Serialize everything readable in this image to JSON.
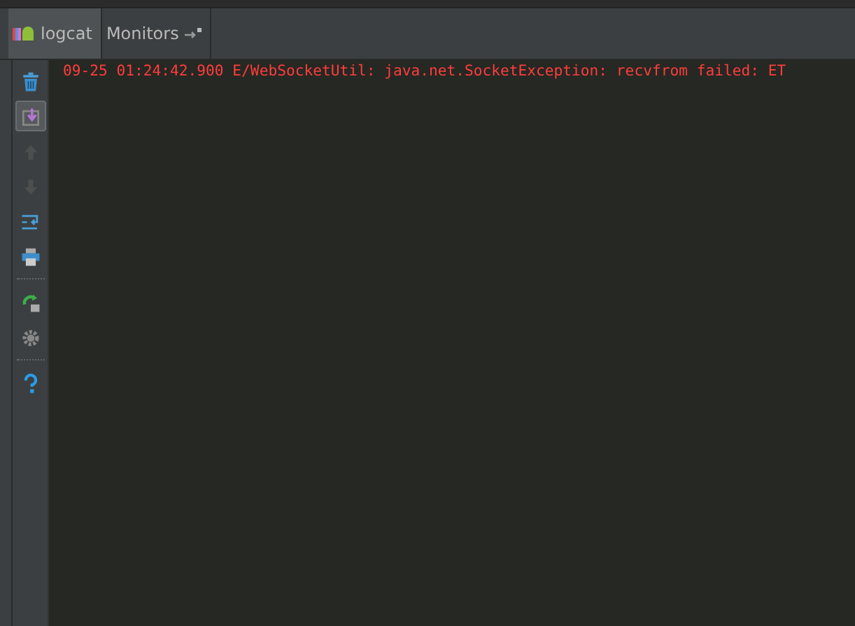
{
  "tabs": [
    {
      "label": "logcat",
      "kind": "logcat",
      "selected": true
    },
    {
      "label": "Monitors",
      "kind": "monitors",
      "selected": false
    }
  ],
  "toolbar": [
    {
      "kind": "trash",
      "on": false,
      "disabled": false
    },
    {
      "kind": "scroll-end",
      "on": true,
      "disabled": false
    },
    {
      "kind": "up",
      "on": false,
      "disabled": true
    },
    {
      "kind": "down",
      "on": false,
      "disabled": true
    },
    {
      "kind": "wrap",
      "on": false,
      "disabled": false
    },
    {
      "kind": "print",
      "on": false,
      "disabled": false
    },
    {
      "kind": "separator"
    },
    {
      "kind": "restart",
      "on": false,
      "disabled": false
    },
    {
      "kind": "gear",
      "on": false,
      "disabled": false
    },
    {
      "kind": "separator"
    },
    {
      "kind": "help",
      "on": false,
      "disabled": false
    }
  ],
  "log_lines": [
    "09-25 01:24:42.900 E/WebSocketUtil: java.net.SocketException: recvfrom failed: ET"
  ]
}
